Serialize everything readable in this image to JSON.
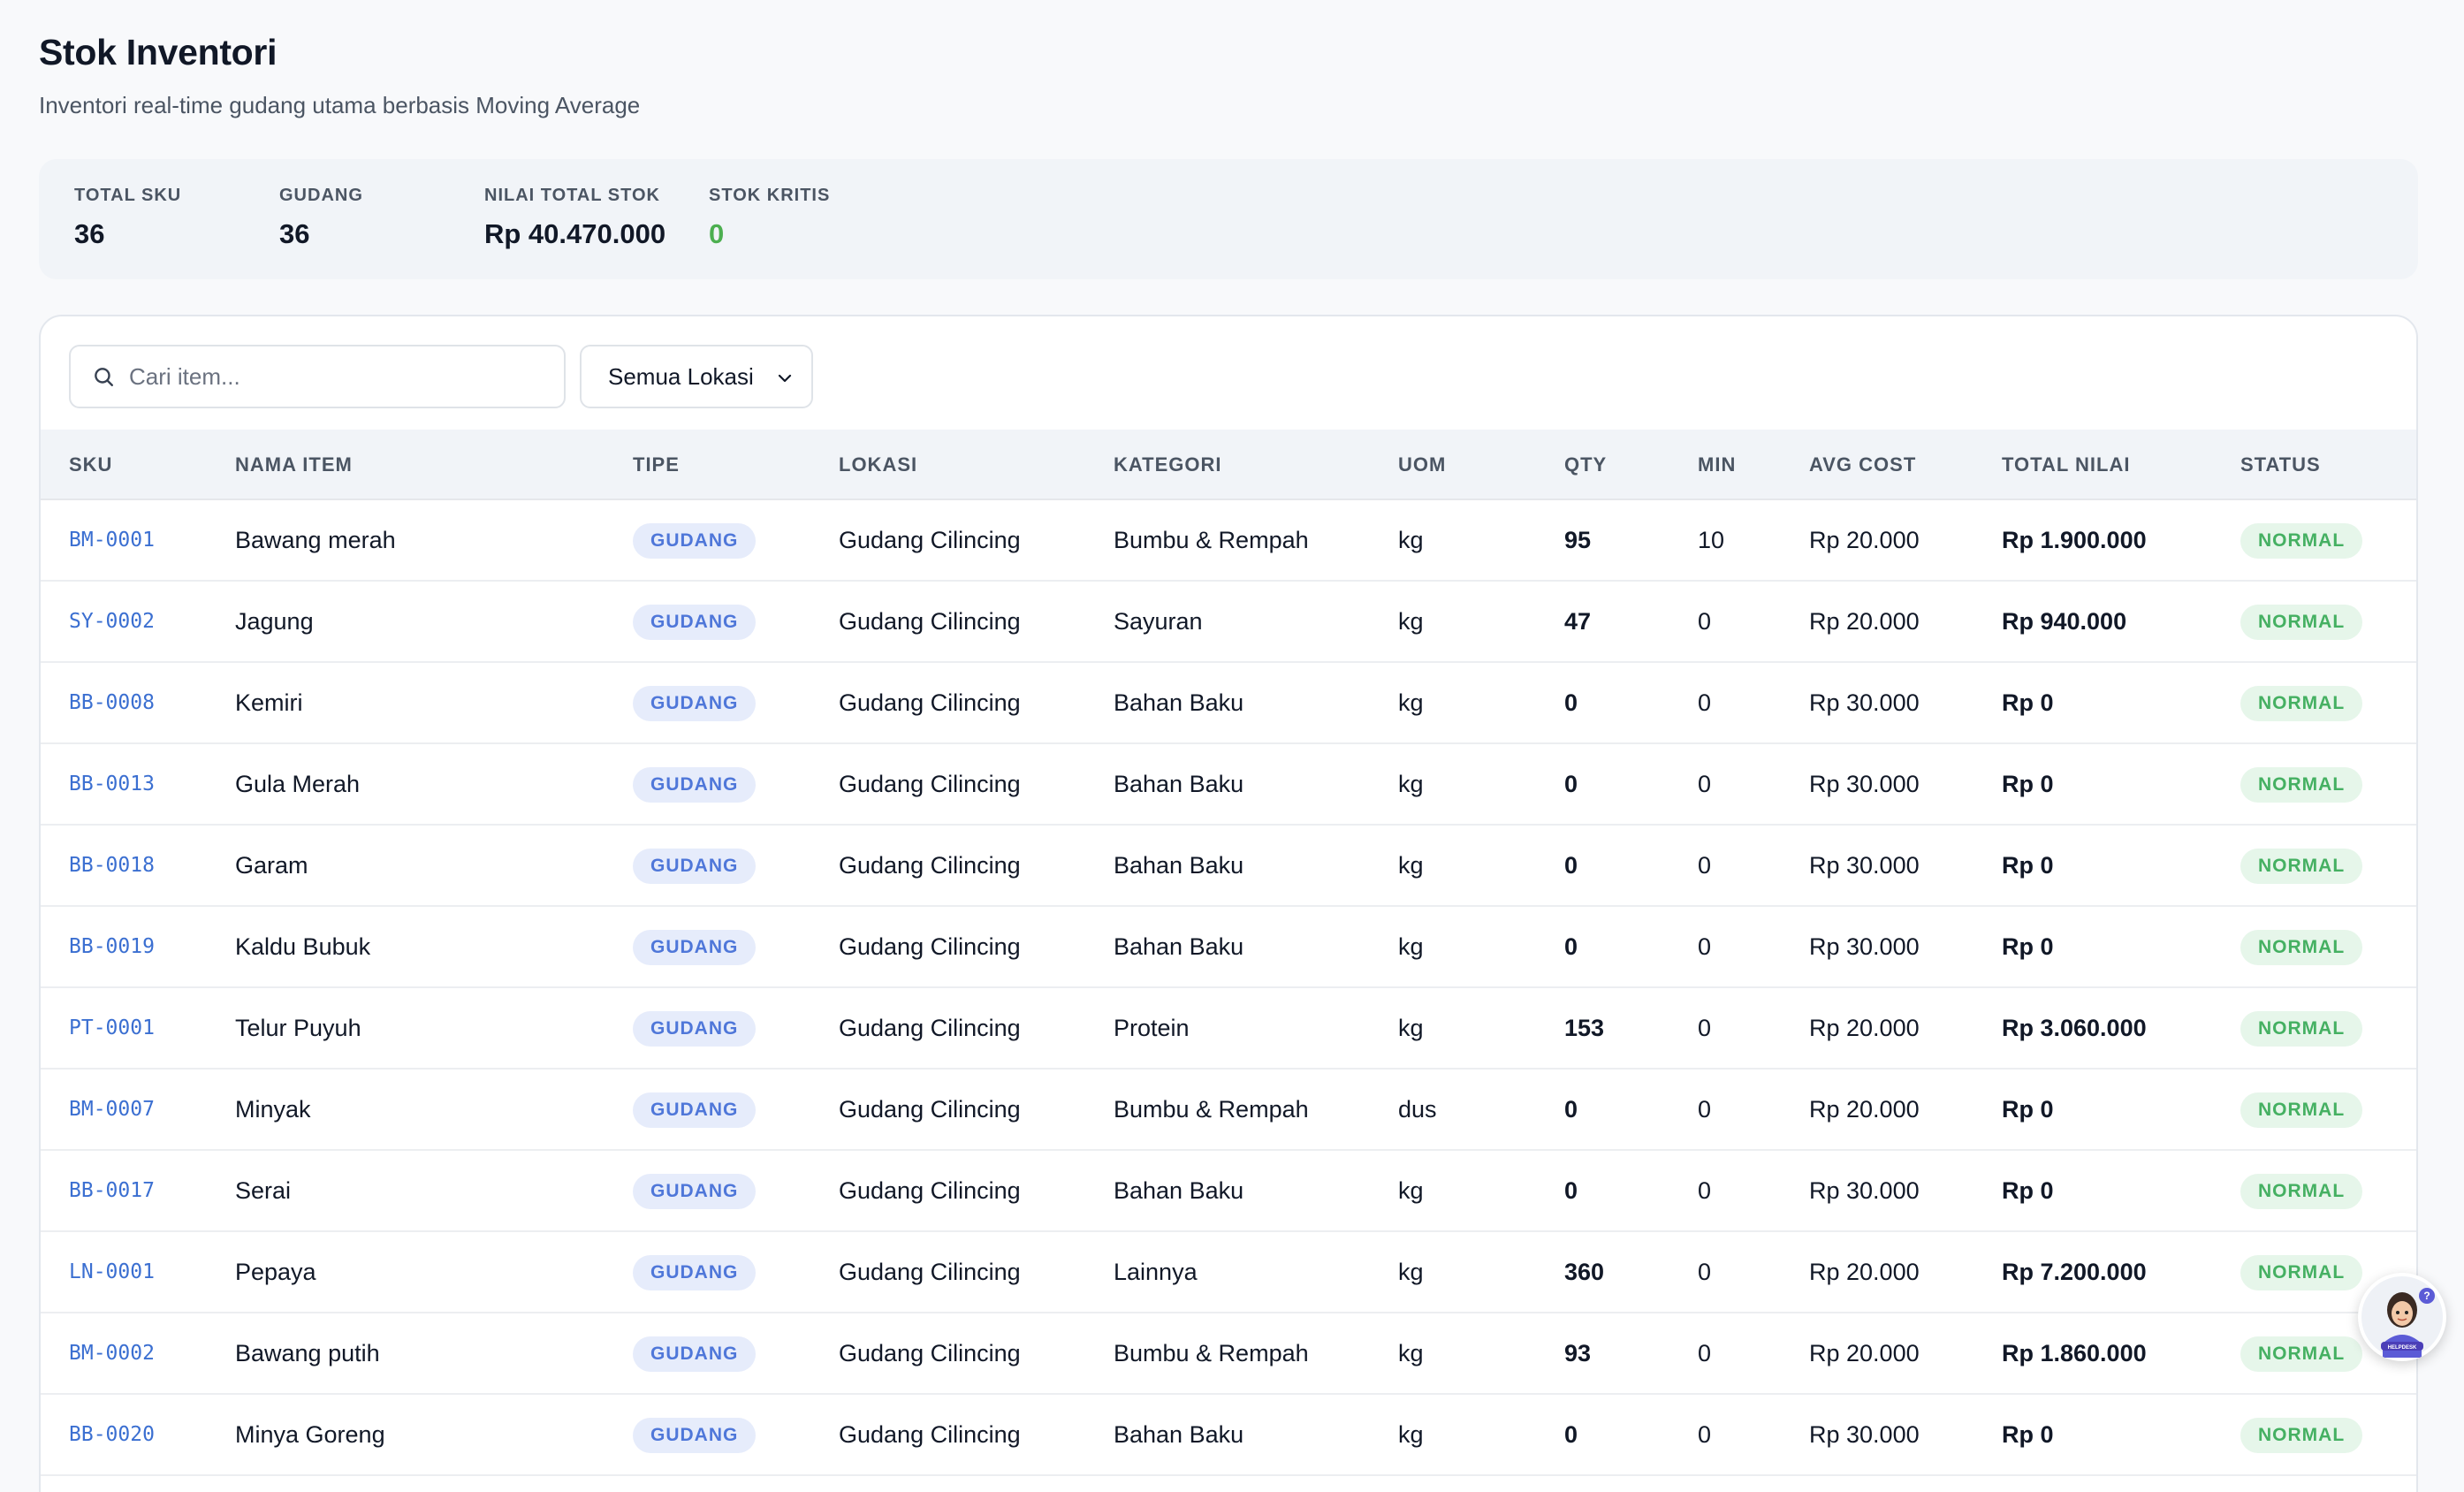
{
  "page": {
    "title": "Stok Inventori",
    "subtitle": "Inventori real-time gudang utama berbasis Moving Average"
  },
  "stats": [
    {
      "label": "TOTAL SKU",
      "value": "36"
    },
    {
      "label": "GUDANG",
      "value": "36"
    },
    {
      "label": "NILAI TOTAL STOK",
      "value": "Rp 40.470.000"
    },
    {
      "label": "STOK KRITIS",
      "value": "0"
    }
  ],
  "filters": {
    "search_placeholder": "Cari item...",
    "location_selected": "Semua Lokasi"
  },
  "table": {
    "headers": [
      "SKU",
      "NAMA ITEM",
      "TIPE",
      "LOKASI",
      "KATEGORI",
      "UOM",
      "QTY",
      "MIN",
      "AVG COST",
      "TOTAL NILAI",
      "STATUS"
    ],
    "rows": [
      {
        "sku": "BM-0001",
        "name": "Bawang merah",
        "type": "GUDANG",
        "location": "Gudang Cilincing",
        "category": "Bumbu & Rempah",
        "uom": "kg",
        "qty": "95",
        "min": "10",
        "avg_cost": "Rp 20.000",
        "total": "Rp 1.900.000",
        "status": "NORMAL"
      },
      {
        "sku": "SY-0002",
        "name": "Jagung",
        "type": "GUDANG",
        "location": "Gudang Cilincing",
        "category": "Sayuran",
        "uom": "kg",
        "qty": "47",
        "min": "0",
        "avg_cost": "Rp 20.000",
        "total": "Rp 940.000",
        "status": "NORMAL"
      },
      {
        "sku": "BB-0008",
        "name": "Kemiri",
        "type": "GUDANG",
        "location": "Gudang Cilincing",
        "category": "Bahan Baku",
        "uom": "kg",
        "qty": "0",
        "min": "0",
        "avg_cost": "Rp 30.000",
        "total": "Rp 0",
        "status": "NORMAL"
      },
      {
        "sku": "BB-0013",
        "name": "Gula Merah",
        "type": "GUDANG",
        "location": "Gudang Cilincing",
        "category": "Bahan Baku",
        "uom": "kg",
        "qty": "0",
        "min": "0",
        "avg_cost": "Rp 30.000",
        "total": "Rp 0",
        "status": "NORMAL"
      },
      {
        "sku": "BB-0018",
        "name": "Garam",
        "type": "GUDANG",
        "location": "Gudang Cilincing",
        "category": "Bahan Baku",
        "uom": "kg",
        "qty": "0",
        "min": "0",
        "avg_cost": "Rp 30.000",
        "total": "Rp 0",
        "status": "NORMAL"
      },
      {
        "sku": "BB-0019",
        "name": "Kaldu Bubuk",
        "type": "GUDANG",
        "location": "Gudang Cilincing",
        "category": "Bahan Baku",
        "uom": "kg",
        "qty": "0",
        "min": "0",
        "avg_cost": "Rp 30.000",
        "total": "Rp 0",
        "status": "NORMAL"
      },
      {
        "sku": "PT-0001",
        "name": "Telur Puyuh",
        "type": "GUDANG",
        "location": "Gudang Cilincing",
        "category": "Protein",
        "uom": "kg",
        "qty": "153",
        "min": "0",
        "avg_cost": "Rp 20.000",
        "total": "Rp 3.060.000",
        "status": "NORMAL"
      },
      {
        "sku": "BM-0007",
        "name": "Minyak",
        "type": "GUDANG",
        "location": "Gudang Cilincing",
        "category": "Bumbu & Rempah",
        "uom": "dus",
        "qty": "0",
        "min": "0",
        "avg_cost": "Rp 20.000",
        "total": "Rp 0",
        "status": "NORMAL"
      },
      {
        "sku": "BB-0017",
        "name": "Serai",
        "type": "GUDANG",
        "location": "Gudang Cilincing",
        "category": "Bahan Baku",
        "uom": "kg",
        "qty": "0",
        "min": "0",
        "avg_cost": "Rp 30.000",
        "total": "Rp 0",
        "status": "NORMAL"
      },
      {
        "sku": "LN-0001",
        "name": "Pepaya",
        "type": "GUDANG",
        "location": "Gudang Cilincing",
        "category": "Lainnya",
        "uom": "kg",
        "qty": "360",
        "min": "0",
        "avg_cost": "Rp 20.000",
        "total": "Rp 7.200.000",
        "status": "NORMAL"
      },
      {
        "sku": "BM-0002",
        "name": "Bawang putih",
        "type": "GUDANG",
        "location": "Gudang Cilincing",
        "category": "Bumbu & Rempah",
        "uom": "kg",
        "qty": "93",
        "min": "0",
        "avg_cost": "Rp 20.000",
        "total": "Rp 1.860.000",
        "status": "NORMAL"
      },
      {
        "sku": "BB-0020",
        "name": "Minya Goreng",
        "type": "GUDANG",
        "location": "Gudang Cilincing",
        "category": "Bahan Baku",
        "uom": "kg",
        "qty": "0",
        "min": "0",
        "avg_cost": "Rp 30.000",
        "total": "Rp 0",
        "status": "NORMAL"
      }
    ]
  },
  "helpdesk": {
    "badge": "?",
    "label": "HELPDESK",
    "icon": "helpdesk-avatar-icon"
  },
  "colors": {
    "accent": "#3b6fd1",
    "type_pill_bg": "#e6ecfb",
    "status_normal_bg": "#e6f6ea",
    "status_normal_fg": "#45b062",
    "critical_green": "#4caf50"
  }
}
